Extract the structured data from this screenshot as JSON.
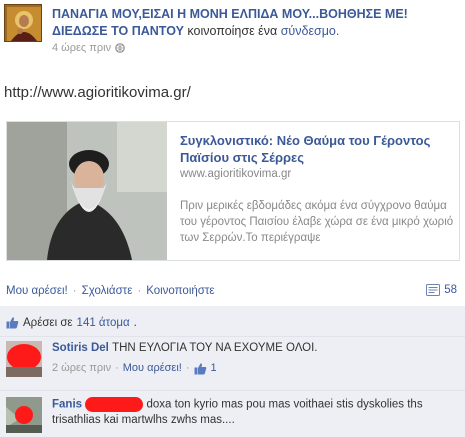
{
  "header": {
    "page_name": "ΠΑΝΑΓΙΑ ΜΟΥ,ΕΙΣΑΙ Η ΜΟΝΗ ΕΛΠΙΔΑ ΜΟΥ...ΒΟΗΘΗΣΕ ΜΕ! ΔΙΕΔΩΣΕ ΤΟ ΠΑΝΤΟΥ",
    "share_prefix": "κοινοποίησε ένα",
    "share_link": "σύνδεσμο.",
    "timestamp": "4 ώρες πριν"
  },
  "post": {
    "url": "http://www.agioritikovima.gr/"
  },
  "preview": {
    "title": "Συγκλονιστικό: Νέο Θαύμα του Γέροντος Παϊσίου στις Σέρρες",
    "domain": "www.agioritikovima.gr",
    "description": "Πριν μερικές εβδομάδες ακόμα ένα σύγχρονο θαύμα του γέροντος Παισίου έλαβε χώρα σε ένα μικρό χωριό των Σερρών.Το περιέγραψε"
  },
  "actions": {
    "like": "Μου αρέσει!",
    "comment": "Σχολιάστε",
    "share": "Κοινοποιήστε",
    "separator": "·",
    "share_count": "58"
  },
  "likes": {
    "prefix": "Αρέσει σε",
    "count": "141 άτομα",
    "suffix": "."
  },
  "comments": [
    {
      "author": "Sotiris Del",
      "text": "ΤΗΝ ΕΥΛΟΓΙΑ ΤΟΥ ΝΑ ΕΧΟΥΜΕ ΟΛΟΙ.",
      "time": "2 ώρες πριν",
      "like_label": "Μου αρέσει!",
      "like_count": "1"
    },
    {
      "author": "Fanis",
      "text": "doxa ton kyrio mas pou mas voithaei stis dyskolies ths trisathlias kai martwlhs zwhs mas...."
    }
  ],
  "colors": {
    "link": "#3b5998",
    "ufi_background": "#edeff4",
    "redaction": "#ff1a1a"
  }
}
